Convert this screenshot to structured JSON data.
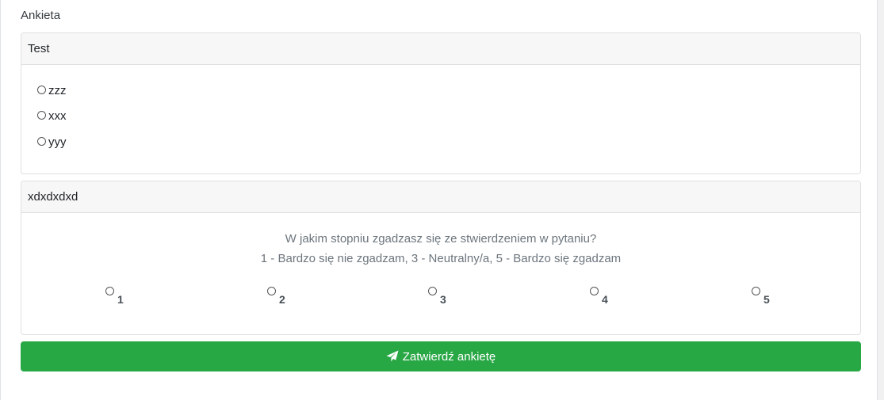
{
  "page": {
    "title": "Ankieta"
  },
  "questions": [
    {
      "title": "Test",
      "options": [
        "zzz",
        "xxx",
        "yyy"
      ]
    },
    {
      "title": "xdxdxdxd",
      "prompt_line1": "W jakim stopniu zgadzasz się ze stwierdzeniem w pytaniu?",
      "prompt_line2": "1 - Bardzo się nie zgadzam, 3 - Neutralny/a, 5 - Bardzo się zgadzam",
      "scale": [
        "1",
        "2",
        "3",
        "4",
        "5"
      ]
    }
  ],
  "submit": {
    "label": "Zatwierdź ankietę",
    "icon": "paper-plane-icon",
    "color": "#28a745"
  }
}
